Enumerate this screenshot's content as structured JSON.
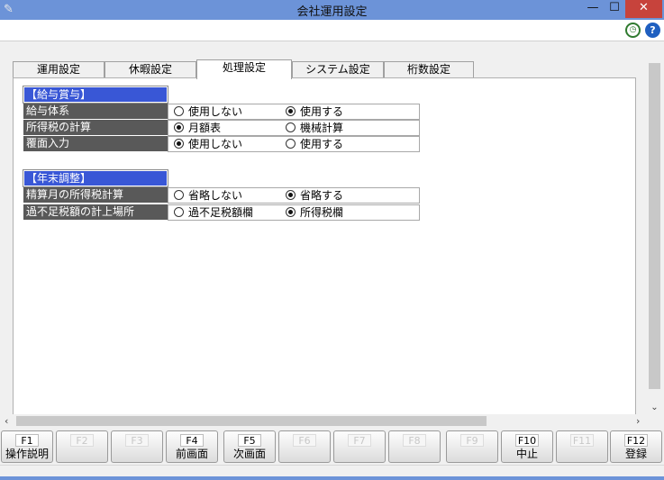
{
  "window": {
    "title": "会社運用設定",
    "minimize": "—",
    "maximize": "☐",
    "close": "✕"
  },
  "tabs": [
    {
      "label": "運用設定",
      "active": false
    },
    {
      "label": "休暇設定",
      "active": false
    },
    {
      "label": "処理設定",
      "active": true
    },
    {
      "label": "システム設定",
      "active": false
    },
    {
      "label": "桁数設定",
      "active": false
    }
  ],
  "sections": [
    {
      "title": "【給与賞与】",
      "rows": [
        {
          "label": "給与体系",
          "options": [
            "使用しない",
            "使用する"
          ],
          "selected": 1
        },
        {
          "label": "所得税の計算",
          "options": [
            "月額表",
            "機械計算"
          ],
          "selected": 0
        },
        {
          "label": "覆面入力",
          "options": [
            "使用しない",
            "使用する"
          ],
          "selected": 0
        }
      ]
    },
    {
      "title": "【年末調整】",
      "rows": [
        {
          "label": "精算月の所得税計算",
          "options": [
            "省略しない",
            "省略する"
          ],
          "selected": 1
        },
        {
          "label": "過不足税額の計上場所",
          "options": [
            "過不足税額欄",
            "所得税欄"
          ],
          "selected": 1
        }
      ]
    }
  ],
  "fkeys": [
    {
      "key": "F1",
      "label": "操作説明",
      "enabled": true
    },
    {
      "key": "F2",
      "label": "",
      "enabled": false
    },
    {
      "key": "F3",
      "label": "",
      "enabled": false
    },
    {
      "key": "F4",
      "label": "前画面",
      "enabled": true
    },
    {
      "key": "F5",
      "label": "次画面",
      "enabled": true
    },
    {
      "key": "F6",
      "label": "",
      "enabled": false
    },
    {
      "key": "F7",
      "label": "",
      "enabled": false
    },
    {
      "key": "F8",
      "label": "",
      "enabled": false
    },
    {
      "key": "F9",
      "label": "",
      "enabled": false
    },
    {
      "key": "F10",
      "label": "中止",
      "enabled": true
    },
    {
      "key": "F11",
      "label": "",
      "enabled": false
    },
    {
      "key": "F12",
      "label": "登録",
      "enabled": true
    }
  ],
  "colors": {
    "titlebar": "#6c93d8",
    "section_head": "#3957d6",
    "row_label": "#595959",
    "close": "#c7433c"
  }
}
